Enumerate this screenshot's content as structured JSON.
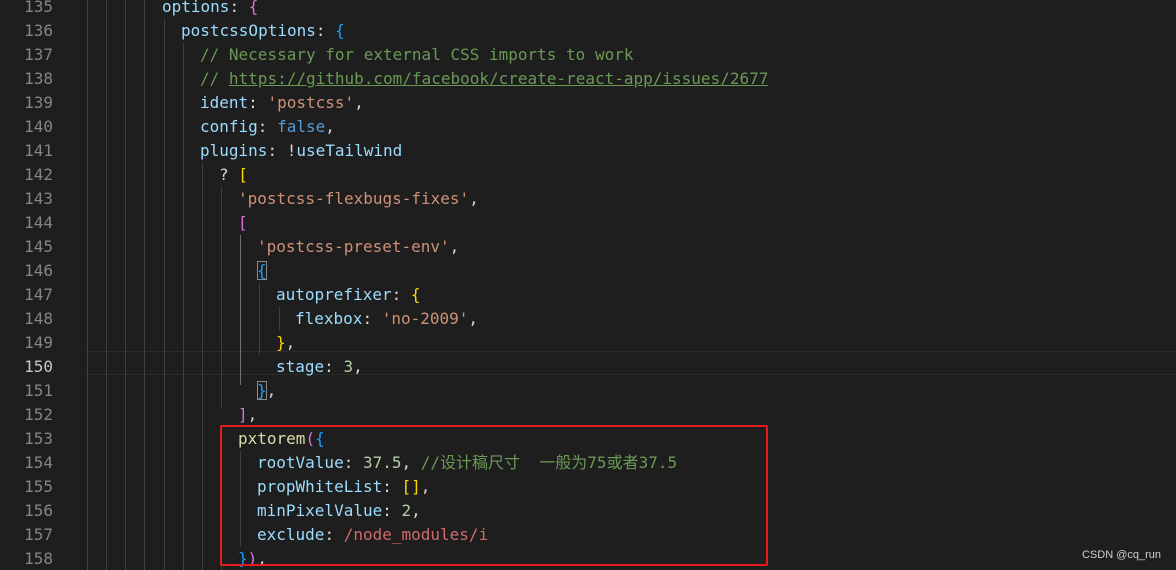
{
  "editor": {
    "line_numbers": [
      "135",
      "136",
      "137",
      "138",
      "139",
      "140",
      "141",
      "142",
      "143",
      "144",
      "145",
      "146",
      "147",
      "148",
      "149",
      "150",
      "151",
      "152",
      "153",
      "154",
      "155",
      "156",
      "157",
      "158"
    ],
    "active_line_number": "150",
    "code": {
      "l135": {
        "key": "options",
        "colon": ": ",
        "brace": "{"
      },
      "l136": {
        "key": "postcssOptions",
        "colon": ": ",
        "brace": "{"
      },
      "l137": {
        "comment": "// Necessary for external CSS imports to work"
      },
      "l138": {
        "comment_prefix": "// ",
        "link": "https://github.com/facebook/create-react-app/issues/2677"
      },
      "l139": {
        "key": "ident",
        "colon": ": ",
        "value": "'postcss'",
        "comma": ","
      },
      "l140": {
        "key": "config",
        "colon": ": ",
        "value": "false",
        "comma": ","
      },
      "l141": {
        "key": "plugins",
        "colon": ": ",
        "not": "!",
        "ident": "useTailwind"
      },
      "l142": {
        "ternary": "? ",
        "bracket": "["
      },
      "l143": {
        "value": "'postcss-flexbugs-fixes'",
        "comma": ","
      },
      "l144": {
        "bracket": "["
      },
      "l145": {
        "value": "'postcss-preset-env'",
        "comma": ","
      },
      "l146": {
        "brace": "{"
      },
      "l147": {
        "key": "autoprefixer",
        "colon": ": ",
        "brace": "{"
      },
      "l148": {
        "key": "flexbox",
        "colon": ": ",
        "value": "'no-2009'",
        "comma": ","
      },
      "l149": {
        "brace": "}",
        "comma": ","
      },
      "l150": {
        "key": "stage",
        "colon": ": ",
        "value": "3",
        "comma": ","
      },
      "l151": {
        "brace": "}",
        "comma": ","
      },
      "l152": {
        "bracket": "]",
        "comma": ","
      },
      "l153": {
        "fn": "pxtorem",
        "paren": "(",
        "brace": "{"
      },
      "l154": {
        "key": "rootValue",
        "colon": ": ",
        "value": "37.5",
        "comma": ", ",
        "comment": "//设计稿尺寸  一般为75或者37.5"
      },
      "l155": {
        "key": "propWhiteList",
        "colon": ": ",
        "bracket_open": "[",
        "bracket_close": "]",
        "comma": ","
      },
      "l156": {
        "key": "minPixelValue",
        "colon": ": ",
        "value": "2",
        "comma": ","
      },
      "l157": {
        "key": "exclude",
        "colon": ": ",
        "value": "/node_modules/i"
      },
      "l158": {
        "brace": "}",
        "paren": ")",
        "comma": ","
      }
    }
  },
  "watermark": "CSDN @cq_run",
  "colors": {
    "background": "#1e1e1e",
    "property": "#9cdcfe",
    "string": "#ce9178",
    "number": "#b5cea8",
    "keyword": "#569cd6",
    "function": "#dcdcaa",
    "comment": "#6a9955",
    "regex": "#d16969",
    "bracket_level_1": "#ffd700",
    "bracket_level_2": "#da70d6",
    "bracket_level_3": "#179fff",
    "annotation_box": "#e51c1c"
  }
}
